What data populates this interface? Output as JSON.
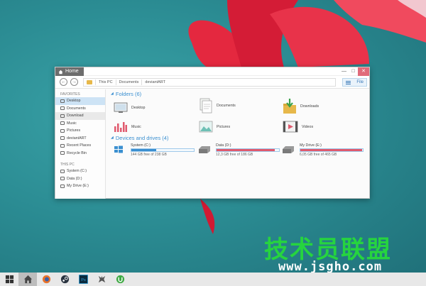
{
  "window": {
    "title": "Home",
    "controls": {
      "minimize": "—",
      "maximize": "□",
      "close": "✕"
    }
  },
  "toolbar": {
    "back": "←",
    "forward": "→",
    "breadcrumb": [
      "This PC",
      "Documents",
      "deviantART"
    ],
    "file_label": "File"
  },
  "sidebar": {
    "favorites_heading": "FAVORITES",
    "favorites": [
      {
        "label": "Desktop",
        "state": "active"
      },
      {
        "label": "Documents",
        "state": ""
      },
      {
        "label": "Download",
        "state": "hover"
      },
      {
        "label": "Music",
        "state": ""
      },
      {
        "label": "Pictures",
        "state": ""
      },
      {
        "label": "deviantART",
        "state": ""
      },
      {
        "label": "Recent Places",
        "state": ""
      },
      {
        "label": "Recycle Bin",
        "state": ""
      }
    ],
    "thispc_heading": "THIS PC",
    "thispc": [
      {
        "label": "System (C:)"
      },
      {
        "label": "Data (D:)"
      },
      {
        "label": "My Drive (E:)"
      }
    ]
  },
  "folders": {
    "heading": "Folders (6)",
    "items": [
      {
        "label": "Desktop",
        "icon": "desktop-icon"
      },
      {
        "label": "Documents",
        "icon": "documents-icon"
      },
      {
        "label": "Downloads",
        "icon": "downloads-icon"
      },
      {
        "label": "Music",
        "icon": "music-icon"
      },
      {
        "label": "Pictures",
        "icon": "pictures-icon"
      },
      {
        "label": "Videos",
        "icon": "videos-icon"
      }
    ]
  },
  "drives": {
    "heading": "Devices and drives (4)",
    "items": [
      {
        "label": "System (C:)",
        "free_text": "144 GB free of 238 GB",
        "used_fraction": 0.4,
        "color": "#3a8fd0"
      },
      {
        "label": "Data (D:)",
        "free_text": "12,3 GB free of 186 GB",
        "used_fraction": 0.93,
        "color": "#e05a6e"
      },
      {
        "label": "My Drive (E:)",
        "free_text": "6,05 GB free of 465 GB",
        "used_fraction": 0.99,
        "color": "#e05a6e"
      }
    ]
  },
  "taskbar": {
    "items": [
      "windows-start-icon",
      "home-explorer-icon",
      "firefox-icon",
      "steam-icon",
      "photoshop-icon",
      "deviantart-icon",
      "utorrent-icon"
    ],
    "photoshop_label": "Ps"
  },
  "watermark": {
    "cn": "技术员联盟",
    "url": "www.jsgho.com"
  }
}
